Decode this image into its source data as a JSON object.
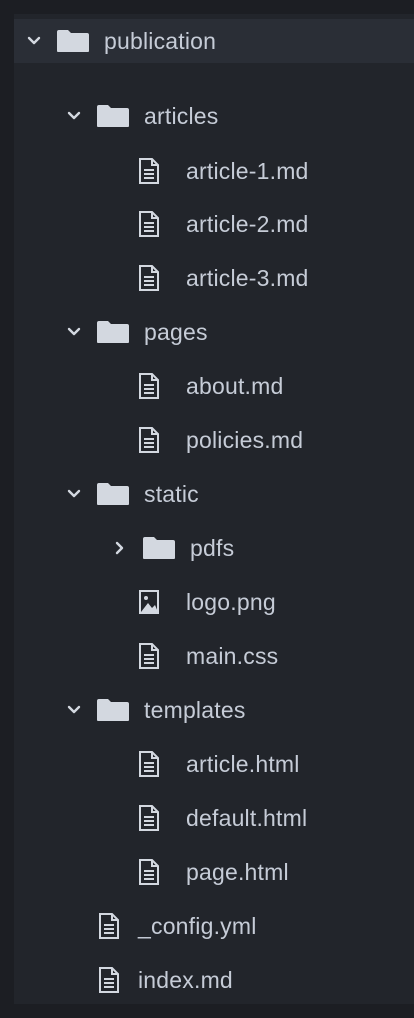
{
  "tree": {
    "root": {
      "label": "publication",
      "icon": "folder-icon",
      "expanded": true
    },
    "items": [
      {
        "label": "articles",
        "type": "folder",
        "expanded": true
      },
      {
        "label": "article-1.md",
        "type": "file",
        "icon": "document-icon"
      },
      {
        "label": "article-2.md",
        "type": "file",
        "icon": "document-icon"
      },
      {
        "label": "article-3.md",
        "type": "file",
        "icon": "document-icon"
      },
      {
        "label": "pages",
        "type": "folder",
        "expanded": true
      },
      {
        "label": "about.md",
        "type": "file",
        "icon": "document-icon"
      },
      {
        "label": "policies.md",
        "type": "file",
        "icon": "document-icon"
      },
      {
        "label": "static",
        "type": "folder",
        "expanded": true
      },
      {
        "label": "pdfs",
        "type": "folder",
        "expanded": false
      },
      {
        "label": "logo.png",
        "type": "file",
        "icon": "image-icon"
      },
      {
        "label": "main.css",
        "type": "file",
        "icon": "document-icon"
      },
      {
        "label": "templates",
        "type": "folder",
        "expanded": true
      },
      {
        "label": "article.html",
        "type": "file",
        "icon": "document-icon"
      },
      {
        "label": "default.html",
        "type": "file",
        "icon": "document-icon"
      },
      {
        "label": "page.html",
        "type": "file",
        "icon": "document-icon"
      },
      {
        "label": "_config.yml",
        "type": "file",
        "icon": "document-icon"
      },
      {
        "label": "index.md",
        "type": "file",
        "icon": "document-icon"
      }
    ]
  },
  "colors": {
    "background": "#22252b",
    "selected_row": "#2a2e36",
    "text": "#c6ccd7",
    "icon": "#d3d8e0"
  }
}
